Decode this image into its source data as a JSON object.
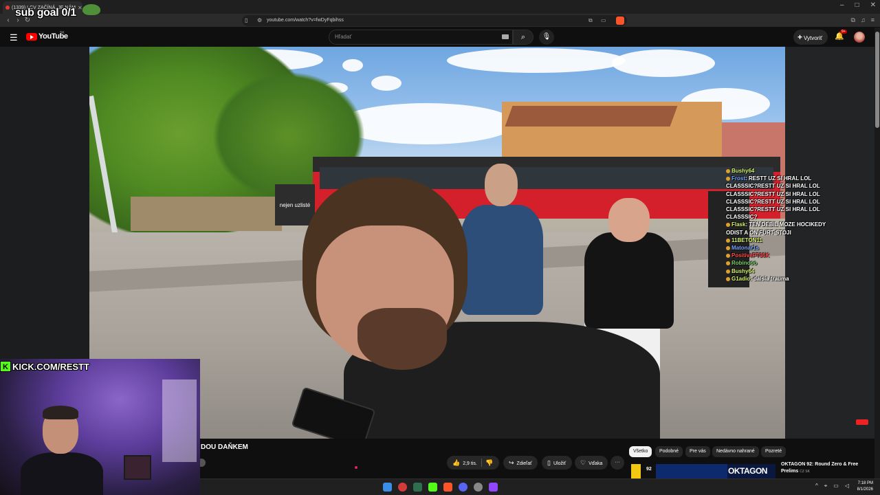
{
  "browser": {
    "tab_title": "(1339) LCV ZAČÍNÁ, JE NÁM",
    "url": "youtube.com/watch?v=fwDyFqbihss",
    "window_controls": [
      "–",
      "□",
      "✕"
    ]
  },
  "overlay": {
    "sub_goal": "sub goal 0/1",
    "kick_handle": "KICK.COM/RESTT"
  },
  "youtube": {
    "logo": "YouTube",
    "region": "SK",
    "search_placeholder": "Hľadať",
    "create_label": "Vytvoriť",
    "notifications_badge": "9+"
  },
  "video": {
    "title_visible": "DOU DAŇKEM",
    "likes": "2,9 tis.",
    "share": "Zdieľať",
    "save": "Uložiť",
    "thanks": "Vďaka",
    "kiosk_text": "nejen uzlisté"
  },
  "chat": [
    {
      "user": "Bushy64",
      "text": "",
      "color": "yellow"
    },
    {
      "user": "Frost",
      "text": "RESTT UZ SI HRAL LOL",
      "color": "blue"
    },
    {
      "user": "",
      "text": "CLASSSIC?RESTT UZ SI HRAL LOL",
      "color": "yellow"
    },
    {
      "user": "",
      "text": "CLASSSIC?RESTT UZ SI HRAL LOL",
      "color": "yellow"
    },
    {
      "user": "",
      "text": "CLASSSIC?RESTT UZ SI HRAL LOL",
      "color": "yellow"
    },
    {
      "user": "",
      "text": "CLASSSIC?RESTT UZ SI HRAL LOL",
      "color": "yellow"
    },
    {
      "user": "",
      "text": "CLASSSIC?",
      "color": "yellow"
    },
    {
      "user": "Flask",
      "text": "TEN DEBIL MOZE HOCIKEDY ODIST A ON FURT STOJI",
      "color": "yellow"
    },
    {
      "user": "11BETON11",
      "text": "",
      "color": "yellow"
    },
    {
      "user": "Matonar1s",
      "text": "",
      "color": "blue"
    },
    {
      "user": "PositiveFT36K",
      "text": "",
      "color": "red"
    },
    {
      "user": "Robinooo",
      "text": "",
      "color": "green"
    },
    {
      "user": "Bushy64",
      "text": "",
      "color": "yellow"
    },
    {
      "user": "G1adio",
      "text": "dalsia trauma",
      "color": "yellow"
    }
  ],
  "chips": [
    "Všetko",
    "Podobné",
    "Pre vás",
    "Nedávno nahrané",
    "Pozreté"
  ],
  "recommendation": {
    "views": "92",
    "brand": "OKTAGON",
    "title": "OKTAGON 92: Round Zero & Free Prelims",
    "badge": "CZ SK"
  },
  "taskbar": {
    "time": "7:18 PM",
    "date": "8/1/2026"
  },
  "colors": {
    "yt_red": "#ff0000",
    "kick_green": "#53fc18",
    "bg": "#0f0f0f"
  }
}
